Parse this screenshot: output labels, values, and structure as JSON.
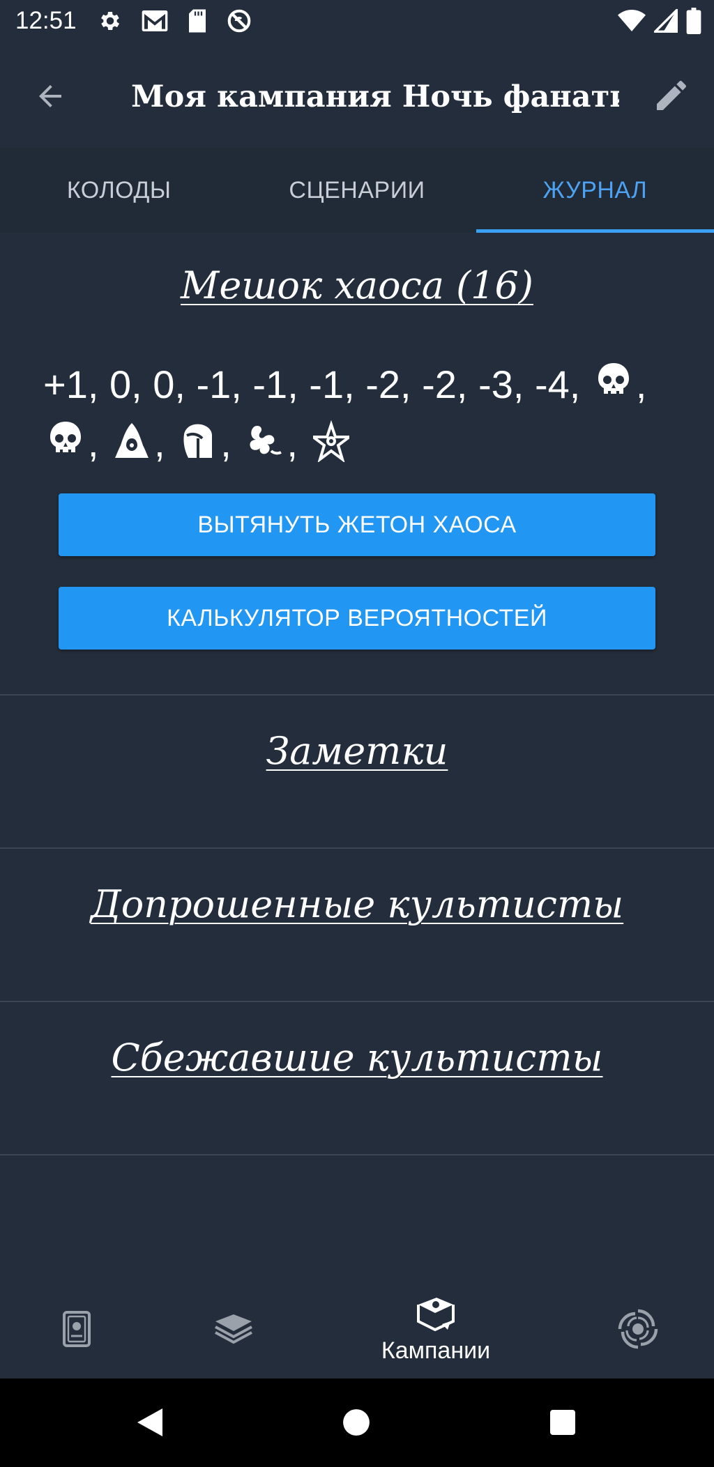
{
  "status_bar": {
    "time": "12:51",
    "icons_left": [
      "settings-icon",
      "gmail-icon",
      "sd-card-icon",
      "sync-off-icon"
    ],
    "icons_right": [
      "wifi-icon",
      "signal-icon",
      "battery-icon"
    ]
  },
  "app_bar": {
    "title": "Моя кампания Ночь фанатич…",
    "back_icon": "arrow-back-icon",
    "edit_icon": "pencil-icon"
  },
  "tabs": [
    {
      "label": "КОЛОДЫ",
      "active": false
    },
    {
      "label": "СЦЕНАРИИ",
      "active": false
    },
    {
      "label": "ЖУРНАЛ",
      "active": true
    }
  ],
  "chaos_bag": {
    "title": "Мешок хаоса (16)",
    "numeric_tokens": "+1, 0, 0, -1, -1, -1, -2, -2, -3, -4,",
    "symbol_tokens": [
      "skull-token-icon",
      "skull-token-icon",
      "cultist-token-icon",
      "tablet-token-icon",
      "elder-thing-token-icon",
      "elder-sign-token-icon"
    ],
    "draw_button": "ВЫТЯНУТЬ ЖЕТОН ХАОСА",
    "odds_button": "КАЛЬКУЛЯТОР ВЕРОЯТНОСТЕЙ"
  },
  "sections": {
    "notes": "Заметки",
    "interrogated": "Допрошенные культисты",
    "escaped": "Сбежавшие культисты"
  },
  "bottom_nav": {
    "items": [
      {
        "icon": "cards-icon",
        "label": ""
      },
      {
        "icon": "decks-icon",
        "label": ""
      },
      {
        "icon": "campaign-book-icon",
        "label": "Кампании"
      },
      {
        "icon": "vortex-icon",
        "label": ""
      }
    ]
  },
  "colors": {
    "background": "#242d3b",
    "accent": "#2196f3",
    "active_tab": "#4da3f2"
  }
}
